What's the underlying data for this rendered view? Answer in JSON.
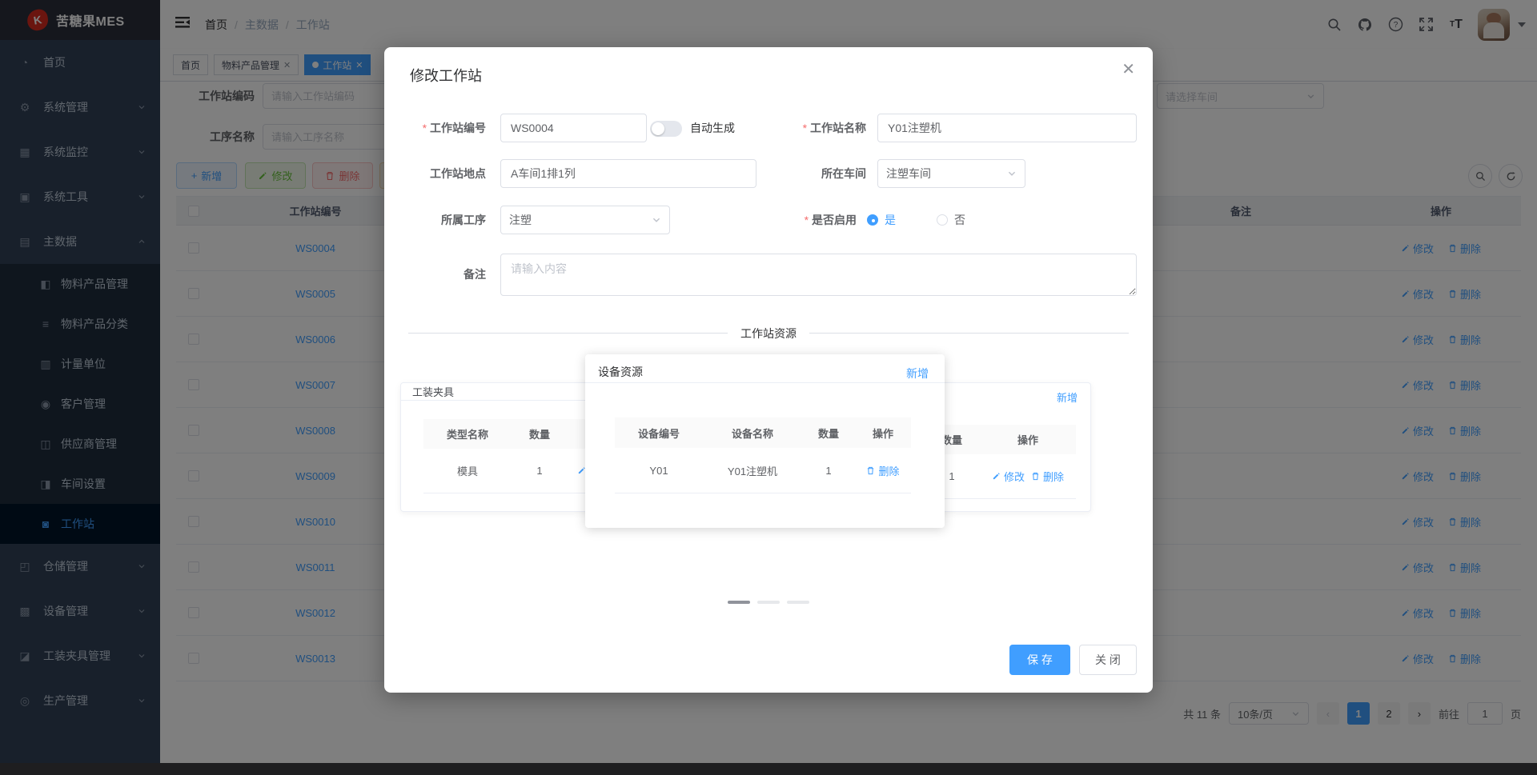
{
  "app": {
    "logo_text": "苦糖果MES"
  },
  "sidebar": {
    "items": [
      {
        "label": "首页"
      },
      {
        "label": "系统管理"
      },
      {
        "label": "系统监控"
      },
      {
        "label": "系统工具"
      },
      {
        "label": "主数据",
        "children": [
          {
            "label": "物料产品管理"
          },
          {
            "label": "物料产品分类"
          },
          {
            "label": "计量单位"
          },
          {
            "label": "客户管理"
          },
          {
            "label": "供应商管理"
          },
          {
            "label": "车间设置"
          },
          {
            "label": "工作站"
          }
        ]
      },
      {
        "label": "仓储管理"
      },
      {
        "label": "设备管理"
      },
      {
        "label": "工装夹具管理"
      },
      {
        "label": "生产管理"
      }
    ]
  },
  "header": {
    "breadcrumb": [
      "首页",
      "主数据",
      "工作站"
    ]
  },
  "tags": {
    "t0": "首页",
    "t1": "物料产品管理",
    "t2": "工作站"
  },
  "filters": {
    "code_label": "工作站编码",
    "code_placeholder": "请输入工作站编码",
    "process_label": "工序名称",
    "process_placeholder": "请输入工序名称",
    "workshop_placeholder": "请选择车间"
  },
  "toolbar": {
    "add": "新增",
    "edit": "修改",
    "remove": "删除"
  },
  "table": {
    "col_code": "工作站编号",
    "col_remark": "备注",
    "col_actions": "操作",
    "action_edit": "修改",
    "action_delete": "删除",
    "rows": [
      {
        "code": "WS0004"
      },
      {
        "code": "WS0005"
      },
      {
        "code": "WS0006"
      },
      {
        "code": "WS0007"
      },
      {
        "code": "WS0008"
      },
      {
        "code": "WS0009"
      },
      {
        "code": "WS0010"
      },
      {
        "code": "WS0011"
      },
      {
        "code": "WS0012"
      },
      {
        "code": "WS0013"
      }
    ]
  },
  "pagination": {
    "total": "共 11 条",
    "page_size": "10条/页",
    "page1": "1",
    "page2": "2",
    "goto_label": "前往",
    "goto_value": "1",
    "goto_unit": "页"
  },
  "modal": {
    "title": "修改工作站",
    "form": {
      "code_label": "工作站编号",
      "code_value": "WS0004",
      "auto_label": "自动生成",
      "name_label": "工作站名称",
      "name_value": "Y01注塑机",
      "location_label": "工作站地点",
      "location_value": "A车间1排1列",
      "workshop_label": "所在车间",
      "workshop_value": "注塑车间",
      "process_label": "所属工序",
      "process_value": "注塑",
      "enabled_label": "是否启用",
      "enabled_yes": "是",
      "enabled_no": "否",
      "remark_label": "备注",
      "remark_placeholder": "请输入内容"
    },
    "section_title": "工作站资源",
    "fixture_card": {
      "title": "工装夹具",
      "col_type": "类型名称",
      "col_qty": "数量",
      "row_type": "模具",
      "row_qty": "1",
      "action_edit": "修改"
    },
    "device_panel": {
      "title": "设备资源",
      "add": "新增",
      "col_code": "设备编号",
      "col_name": "设备名称",
      "col_qty": "数量",
      "col_actions": "操作",
      "row_code": "Y01",
      "row_name": "Y01注塑机",
      "row_qty": "1",
      "action_delete": "删除"
    },
    "third_card": {
      "add": "新增",
      "col_qty": "数量",
      "col_actions": "操作",
      "row_qty": "1",
      "action_edit": "修改",
      "action_delete": "删除"
    },
    "save": "保 存",
    "close": "关 闭"
  },
  "colors": {
    "primary": "#409EFF",
    "success": "#67C23A",
    "danger": "#F56C6C",
    "warning": "#E6A23C",
    "sidebar_bg": "#304156",
    "active_tag": "#409EFF"
  }
}
